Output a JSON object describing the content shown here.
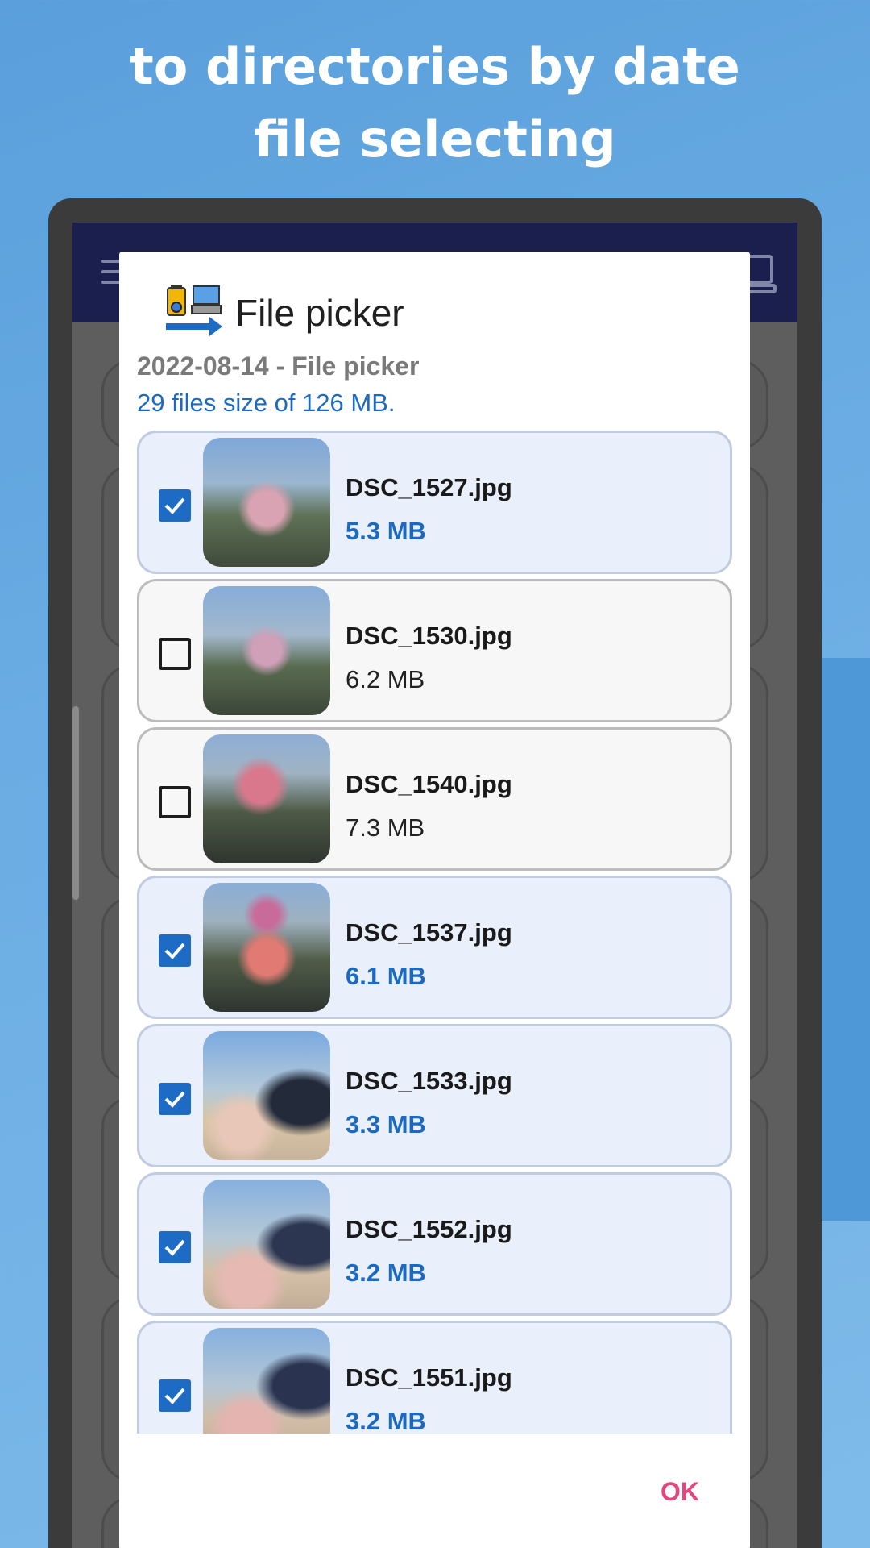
{
  "promo": {
    "line1": "to directories by date",
    "line2": "file selecting"
  },
  "dialog": {
    "title": "File picker",
    "subtitle": "2022-08-14 - File picker",
    "summary": "29 files size of 126 MB.",
    "ok_label": "OK"
  },
  "files": [
    {
      "name": "DSC_1527.jpg",
      "size": "5.3 MB",
      "checked": true
    },
    {
      "name": "DSC_1530.jpg",
      "size": "6.2 MB",
      "checked": false
    },
    {
      "name": "DSC_1540.jpg",
      "size": "7.3 MB",
      "checked": false
    },
    {
      "name": "DSC_1537.jpg",
      "size": "6.1 MB",
      "checked": true
    },
    {
      "name": "DSC_1533.jpg",
      "size": "3.3 MB",
      "checked": true
    },
    {
      "name": "DSC_1552.jpg",
      "size": "3.2 MB",
      "checked": true
    },
    {
      "name": "DSC_1551.jpg",
      "size": "3.2 MB",
      "checked": true
    }
  ],
  "colors": {
    "accent": "#1e6bc6",
    "ok": "#e3467c",
    "app_bar": "#1b1f4d"
  },
  "icons": {
    "app_menu": "hamburger-icon",
    "app_pc": "computer-icon",
    "dialog": "camera-to-pc-transfer-icon",
    "check": "checkmark-icon"
  }
}
